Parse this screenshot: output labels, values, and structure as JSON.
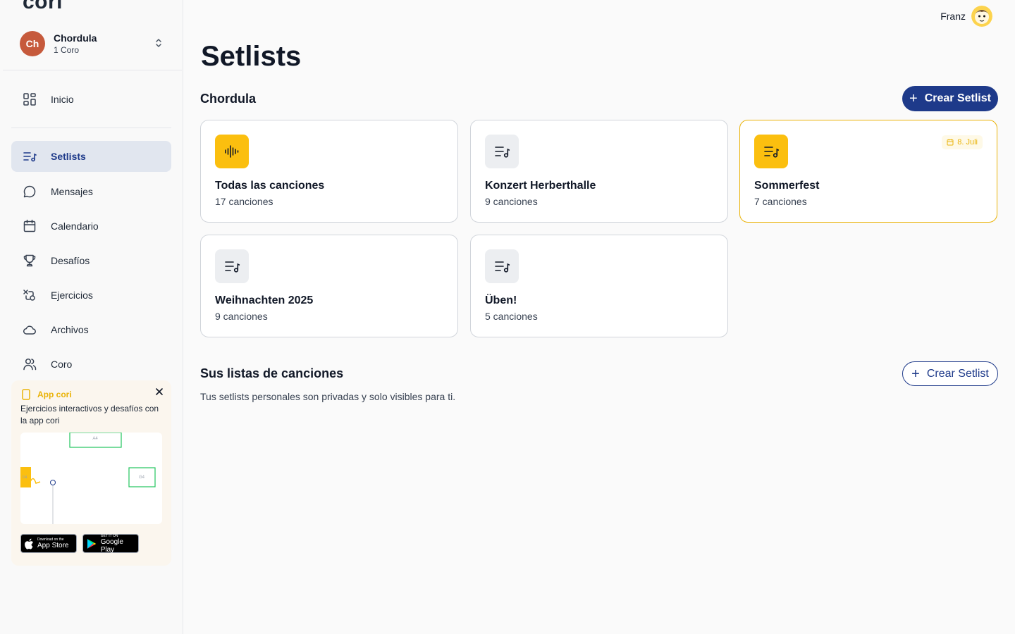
{
  "app": {
    "logo": "cori"
  },
  "choir": {
    "initials": "Ch",
    "name": "Chordula",
    "subtitle": "1 Coro"
  },
  "sidebar": {
    "items": [
      {
        "label": "Inicio",
        "icon": "grid-icon"
      },
      {
        "label": "Setlists",
        "icon": "playlist-icon",
        "active": true
      },
      {
        "label": "Mensajes",
        "icon": "chat-icon"
      },
      {
        "label": "Calendario",
        "icon": "calendar-icon"
      },
      {
        "label": "Desafíos",
        "icon": "trophy-icon"
      },
      {
        "label": "Ejercicios",
        "icon": "exercise-icon"
      },
      {
        "label": "Archivos",
        "icon": "cloud-icon"
      },
      {
        "label": "Coro",
        "icon": "users-icon"
      }
    ]
  },
  "promo": {
    "title": "App cori",
    "text": "Ejercicios interactivos y desafíos con la app cori",
    "preview_notes": [
      "A4",
      "G4",
      "D4"
    ],
    "appstore": {
      "small": "Download on the",
      "large": "App Store"
    },
    "googleplay": {
      "small": "GET IT ON",
      "large": "Google Play"
    }
  },
  "header": {
    "user_name": "Franz"
  },
  "page": {
    "title": "Setlists"
  },
  "group_section": {
    "title": "Chordula",
    "create_label": "Crear Setlist",
    "cards": [
      {
        "title": "Todas las canciones",
        "count": "17 canciones",
        "icon": "waveform-icon",
        "accent": true
      },
      {
        "title": "Konzert Herberthalle",
        "count": "9 canciones",
        "icon": "playlist-icon"
      },
      {
        "title": "Sommerfest",
        "count": "7 canciones",
        "icon": "playlist-icon",
        "accent": true,
        "highlight": true,
        "date": "8. Juli"
      },
      {
        "title": "Weihnachten 2025",
        "count": "9 canciones",
        "icon": "playlist-icon"
      },
      {
        "title": "Üben!",
        "count": "5 canciones",
        "icon": "playlist-icon"
      }
    ]
  },
  "personal_section": {
    "title": "Sus listas de canciones",
    "create_label": "Crear Setlist",
    "description": "Tus setlists personales son privadas y solo visibles para ti."
  },
  "colors": {
    "primary": "#1e3a8a",
    "accent_yellow": "#fbbf0f",
    "choir_avatar": "#c65a3c",
    "active_nav_bg": "#e1e6ef"
  }
}
